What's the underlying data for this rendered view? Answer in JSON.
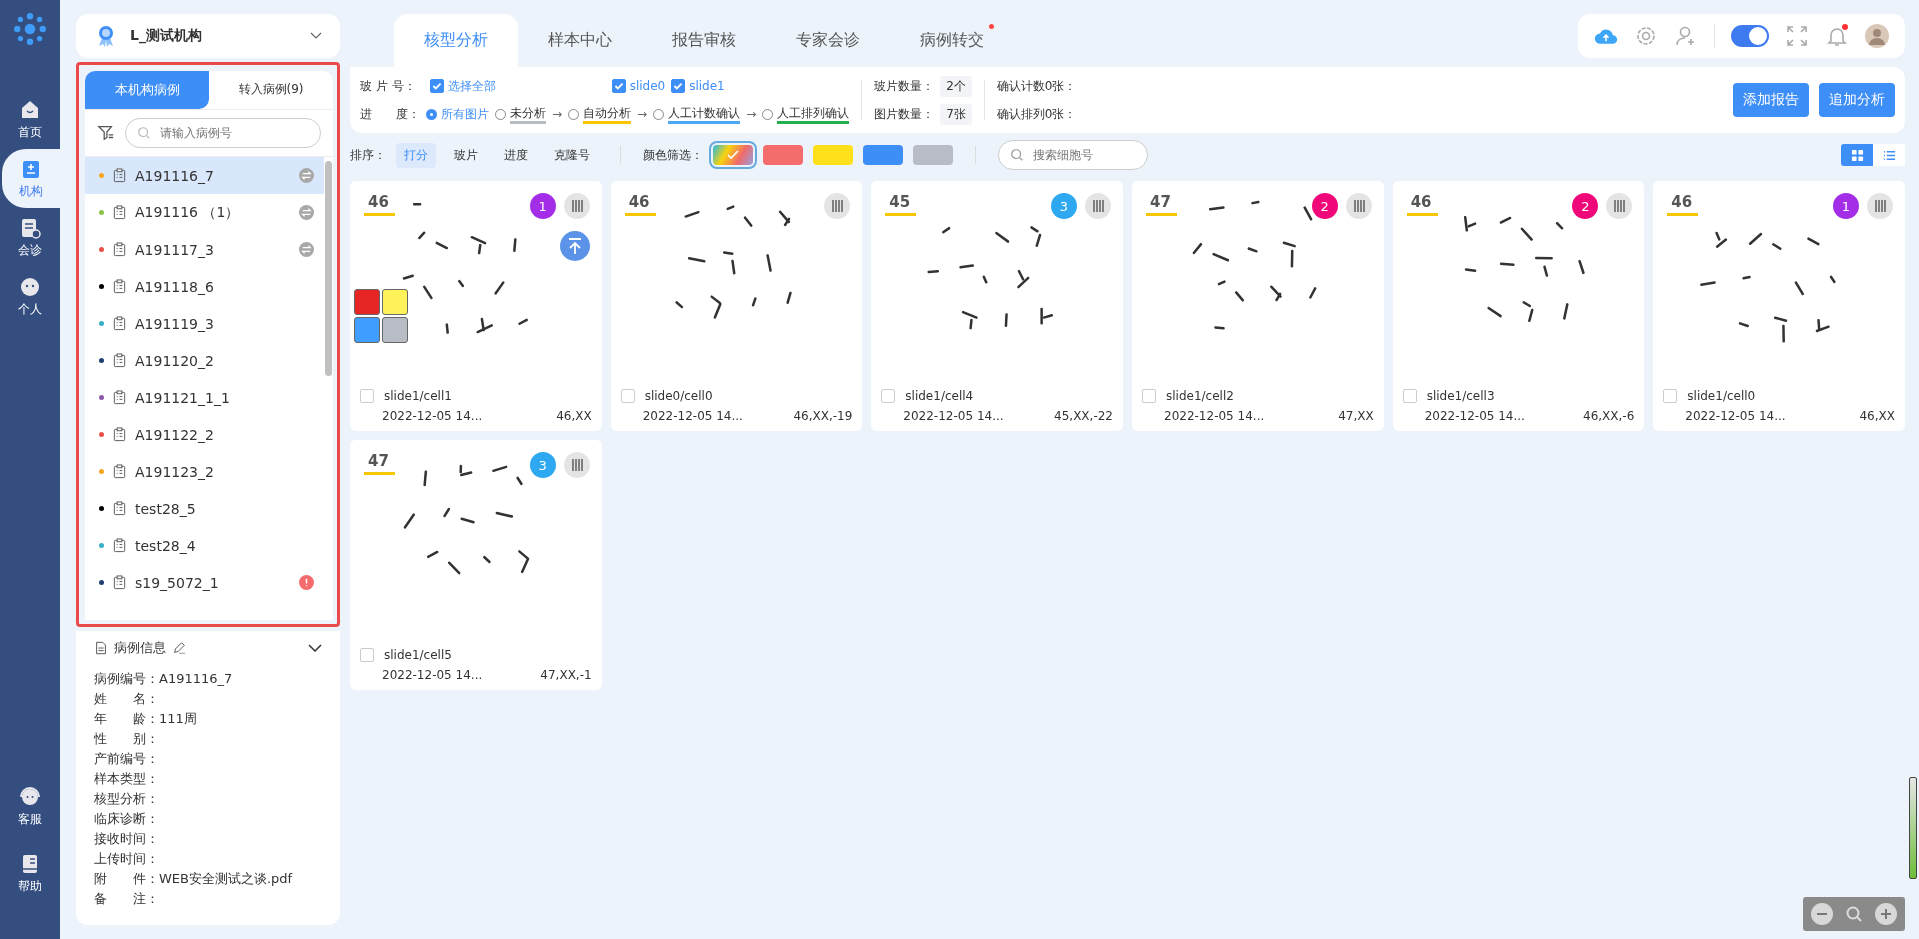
{
  "nav": {
    "items": [
      {
        "kind": "home",
        "label": "首页",
        "selected": false
      },
      {
        "kind": "org",
        "label": "机构",
        "selected": true
      },
      {
        "kind": "consult",
        "label": "会诊",
        "selected": false
      },
      {
        "kind": "person",
        "label": "个人",
        "selected": false
      }
    ],
    "bottom": [
      {
        "kind": "service",
        "label": "客服"
      },
      {
        "kind": "help",
        "label": "帮助"
      }
    ]
  },
  "org": {
    "name": "L_测试机构"
  },
  "case_panel": {
    "tabs": [
      {
        "label": "本机构病例",
        "selected": true
      },
      {
        "label": "转入病例(9)",
        "selected": false
      }
    ],
    "search": {
      "placeholder": "请输入病例号"
    },
    "cases": [
      {
        "label": "A191116_7",
        "color": "#f5a623",
        "selected": true,
        "transfer": true,
        "alert": false
      },
      {
        "label": "A191116 （1）",
        "color": "#8bc34a",
        "selected": false,
        "transfer": true,
        "alert": false
      },
      {
        "label": "A191117_3",
        "color": "#e8504a",
        "selected": false,
        "transfer": true,
        "alert": false
      },
      {
        "label": "A191118_6",
        "color": "#000000",
        "selected": false,
        "transfer": false,
        "alert": false
      },
      {
        "label": "A191119_3",
        "color": "#3ab0c8",
        "selected": false,
        "transfer": false,
        "alert": false
      },
      {
        "label": "A191120_2",
        "color": "#1f3f6e",
        "selected": false,
        "transfer": false,
        "alert": false
      },
      {
        "label": "A191121_1_1",
        "color": "#8a5aa8",
        "selected": false,
        "transfer": false,
        "alert": false
      },
      {
        "label": "A191122_2",
        "color": "#e8504a",
        "selected": false,
        "transfer": false,
        "alert": false
      },
      {
        "label": "A191123_2",
        "color": "#f5a623",
        "selected": false,
        "transfer": false,
        "alert": false
      },
      {
        "label": "test28_5",
        "color": "#000000",
        "selected": false,
        "transfer": false,
        "alert": false
      },
      {
        "label": "test28_4",
        "color": "#3ab0c8",
        "selected": false,
        "transfer": false,
        "alert": false
      },
      {
        "label": "s19_5072_1",
        "color": "#1f3f6e",
        "selected": false,
        "transfer": false,
        "alert": true
      }
    ]
  },
  "info": {
    "title": "病例信息",
    "fields": [
      {
        "label": "病例编号：",
        "value": "A191116_7"
      },
      {
        "label": "姓　　名："
      },
      {
        "label": "年　　龄：",
        "value": "111周"
      },
      {
        "label": "性　　别："
      },
      {
        "label": "产前编号："
      },
      {
        "label": "样本类型："
      },
      {
        "label": "核型分析："
      },
      {
        "label": "临床诊断："
      },
      {
        "label": "接收时间："
      },
      {
        "label": "上传时间："
      },
      {
        "label": "附　　件：",
        "value": "WEB安全测试之谈.pdf"
      },
      {
        "label": "备　　注："
      }
    ]
  },
  "tabs": [
    {
      "label": "核型分析",
      "selected": true,
      "dot": false
    },
    {
      "label": "样本中心",
      "selected": false,
      "dot": false
    },
    {
      "label": "报告审核",
      "selected": false,
      "dot": false
    },
    {
      "label": "专家会诊",
      "selected": false,
      "dot": false
    },
    {
      "label": "病例转交",
      "selected": false,
      "dot": true
    }
  ],
  "toolbar": {
    "theme_on": true,
    "bell_dot": true
  },
  "filter": {
    "slide_label": "玻 片 号：",
    "slides": [
      {
        "label": "选择全部",
        "checked": true
      },
      {
        "label": "slide0",
        "checked": true
      },
      {
        "label": "slide1",
        "checked": true
      }
    ],
    "progress_label": "进　　度：",
    "arrow": "→",
    "stages": [
      {
        "label": "所有图片",
        "selected": true
      },
      {
        "label": "未分析",
        "selected": false,
        "color": "#b8bcc4"
      },
      {
        "label": "自动分析",
        "selected": false,
        "color": "#f7c600"
      },
      {
        "label": "人工计数确认",
        "selected": false,
        "color": "#4aa8f8"
      },
      {
        "label": "人工排列确认",
        "selected": false,
        "color": "#22b04a"
      }
    ],
    "stats": [
      {
        "label": "玻片数量：",
        "value": "2个"
      },
      {
        "label": "图片数量：",
        "value": "7张"
      }
    ],
    "confirms": [
      "确认计数0张：",
      "确认排列0张："
    ],
    "buttons": [
      "添加报告",
      "追加分析"
    ]
  },
  "sort": {
    "label": "排序：",
    "options": [
      {
        "label": "打分",
        "selected": true
      },
      {
        "label": "玻片",
        "selected": false
      },
      {
        "label": "进度",
        "selected": false
      },
      {
        "label": "克隆号",
        "selected": false
      }
    ],
    "color_label": "颜色筛选：",
    "swatches": [
      {
        "kind": "all",
        "selected": true
      },
      {
        "kind": "solid",
        "color": "#f56c6c",
        "selected": false
      },
      {
        "kind": "solid",
        "color": "#ffe01a",
        "selected": false
      },
      {
        "kind": "solid",
        "color": "#3e8ef7",
        "selected": false
      },
      {
        "kind": "solid",
        "color": "#b8bcc4",
        "selected": false
      }
    ],
    "search": {
      "placeholder": "搜索细胞号"
    },
    "views": [
      {
        "kind": "grid",
        "selected": true
      },
      {
        "kind": "list",
        "selected": false
      }
    ]
  },
  "cards": [
    {
      "count": "46",
      "badge": {
        "label": "1",
        "color": "#a42ee8"
      },
      "pinned": true,
      "swatches": [
        {
          "color": "#e82525"
        },
        {
          "color": "#fff25a"
        },
        {
          "color": "#409eff"
        },
        {
          "color": "#b8bcc4"
        }
      ],
      "checked": false,
      "name": "slide1/cell1",
      "date": "2022-12-05 14...",
      "karyotype": "46,XX"
    },
    {
      "count": "46",
      "pinned": false,
      "checked": false,
      "name": "slide0/cell0",
      "date": "2022-12-05 14...",
      "karyotype": "46,XX,-19"
    },
    {
      "count": "45",
      "badge": {
        "label": "3",
        "color": "#2ea8f0"
      },
      "pinned": false,
      "checked": false,
      "name": "slide1/cell4",
      "date": "2022-12-05 14...",
      "karyotype": "45,XX,-22"
    },
    {
      "count": "47",
      "badge": {
        "label": "2",
        "color": "#f0087a"
      },
      "pinned": false,
      "checked": false,
      "name": "slide1/cell2",
      "date": "2022-12-05 14...",
      "karyotype": "47,XX"
    },
    {
      "count": "46",
      "badge": {
        "label": "2",
        "color": "#f0087a"
      },
      "pinned": false,
      "checked": false,
      "name": "slide1/cell3",
      "date": "2022-12-05 14...",
      "karyotype": "46,XX,-6"
    },
    {
      "count": "46",
      "badge": {
        "label": "1",
        "color": "#a42ee8"
      },
      "pinned": false,
      "checked": false,
      "name": "slide1/cell0",
      "date": "2022-12-05 14...",
      "karyotype": "46,XX"
    },
    {
      "count": "47",
      "badge": {
        "label": "3",
        "color": "#2ea8f0"
      },
      "pinned": false,
      "checked": false,
      "name": "slide1/cell5",
      "date": "2022-12-05 14...",
      "karyotype": "47,XX,-1"
    }
  ]
}
